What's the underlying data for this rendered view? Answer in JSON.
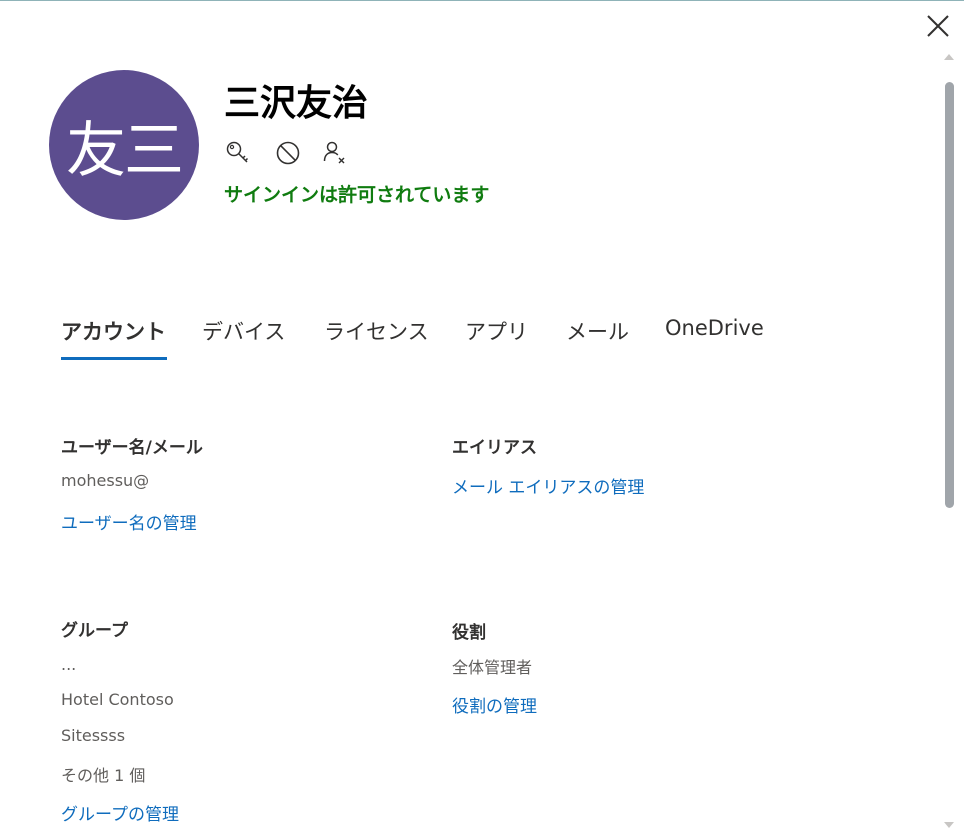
{
  "colors": {
    "avatar_background": "#5c4d8f",
    "status_green": "#107c10",
    "link_blue": "#0f6cbd",
    "tab_accent": "#0f6cbd"
  },
  "header": {
    "avatar_initials": "友三",
    "user_name": "三沢友治",
    "icons": [
      "key-icon",
      "block-icon",
      "remove-user-icon"
    ],
    "signin_status": "サインインは許可されています"
  },
  "tabs": [
    {
      "label": "アカウント",
      "active": true
    },
    {
      "label": "デバイス",
      "active": false
    },
    {
      "label": "ライセンス",
      "active": false
    },
    {
      "label": "アプリ",
      "active": false
    },
    {
      "label": "メール",
      "active": false
    },
    {
      "label": "OneDrive",
      "active": false
    }
  ],
  "account": {
    "username": {
      "label": "ユーザー名/メール",
      "value": "mohessu@",
      "manage_link": "ユーザー名の管理"
    },
    "aliases": {
      "label": "エイリアス",
      "manage_link": "メール エイリアスの管理"
    },
    "groups": {
      "label": "グループ",
      "items": [
        "...",
        "Hotel Contoso",
        "Sitessss"
      ],
      "more": "その他 1 個",
      "manage_link": "グループの管理"
    },
    "roles": {
      "label": "役割",
      "value": "全体管理者",
      "manage_link": "役割の管理"
    }
  }
}
